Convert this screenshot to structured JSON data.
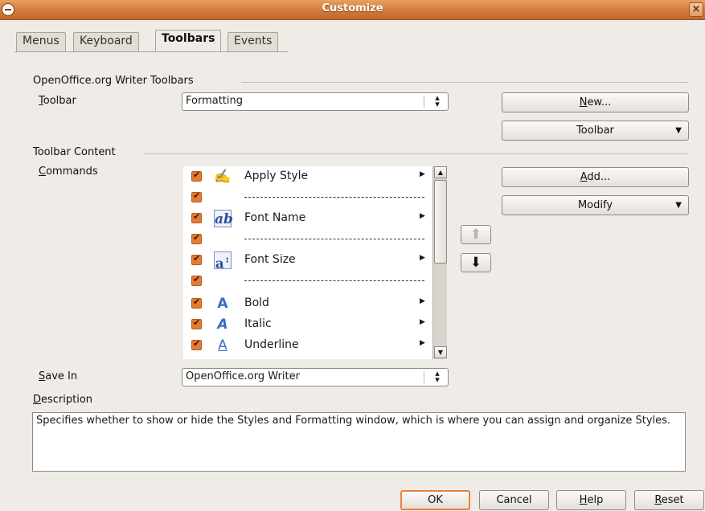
{
  "window": {
    "title": "Customize",
    "close_glyph": "×"
  },
  "tabs": [
    {
      "label": "Menus",
      "active": false
    },
    {
      "label": "Keyboard",
      "active": false
    },
    {
      "label": "Toolbars",
      "active": true
    },
    {
      "label": "Events",
      "active": false
    }
  ],
  "toolbars_section": {
    "title": "OpenOffice.org Writer Toolbars",
    "toolbar_label_mnemonic": "T",
    "toolbar_label_rest": "oolbar",
    "toolbar_value": "Formatting",
    "new_button_mnemonic": "N",
    "new_button_rest": "ew...",
    "toolbar_menu_button": "Toolbar"
  },
  "content_section": {
    "title": "Toolbar Content",
    "commands_label_mnemonic": "C",
    "commands_label_rest": "ommands",
    "add_button_mnemonic": "A",
    "add_button_rest": "dd...",
    "modify_button": "Modify",
    "commands": [
      {
        "type": "item",
        "label": "Apply Style",
        "icon": "apply-style-icon",
        "checked": true
      },
      {
        "type": "separator",
        "checked": true
      },
      {
        "type": "item",
        "label": "Font Name",
        "icon": "font-name-icon",
        "checked": true
      },
      {
        "type": "separator",
        "checked": true
      },
      {
        "type": "item",
        "label": "Font Size",
        "icon": "font-size-icon",
        "checked": true
      },
      {
        "type": "separator",
        "checked": true
      },
      {
        "type": "item",
        "label": "Bold",
        "icon": "bold-icon",
        "checked": true
      },
      {
        "type": "item",
        "label": "Italic",
        "icon": "italic-icon",
        "checked": true
      },
      {
        "type": "item",
        "label": "Underline",
        "icon": "underline-icon",
        "checked": true
      }
    ]
  },
  "save_in": {
    "label_mnemonic": "S",
    "label_rest": "ave In",
    "value": "OpenOffice.org Writer"
  },
  "description": {
    "label_mnemonic": "D",
    "label_rest": "escription",
    "text": "Specifies whether to show or hide the Styles and Formatting window, which is where you can assign and organize Styles."
  },
  "footer": {
    "ok": "OK",
    "cancel": "Cancel",
    "help_mnemonic": "H",
    "help_rest": "elp",
    "reset_mnemonic": "R",
    "reset_rest": "eset"
  },
  "colors": {
    "titlebar": "#d27a3a",
    "checkbox": "#e87a32",
    "default_button_border": "#e8823e"
  }
}
